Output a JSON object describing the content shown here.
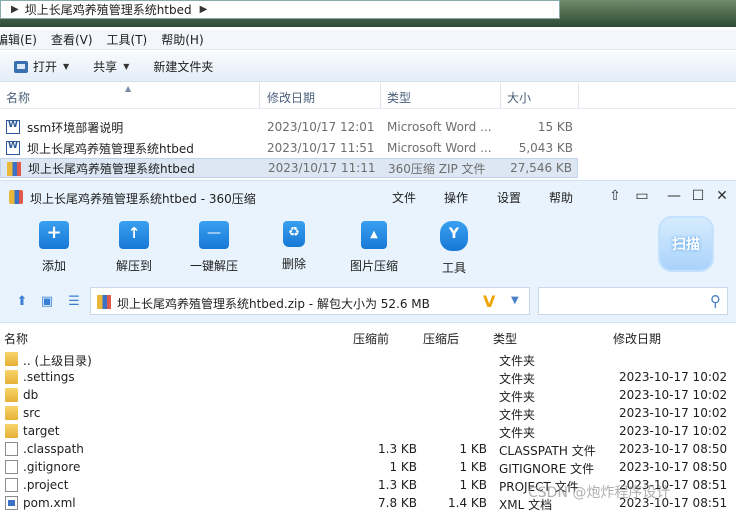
{
  "explorer": {
    "breadcrumb": [
      "坝上长尾鸡养殖管理系统htbed"
    ],
    "menu": [
      "编辑(E)",
      "查看(V)",
      "工具(T)",
      "帮助(H)"
    ],
    "toolbar": {
      "open": "打开",
      "share": "共享",
      "new_folder": "新建文件夹"
    },
    "columns": {
      "name": "名称",
      "date": "修改日期",
      "type": "类型",
      "size": "大小"
    },
    "files": [
      {
        "name": "ssm环境部署说明",
        "date": "2023/10/17 12:01",
        "type": "Microsoft Word ...",
        "size": "15 KB",
        "icon": "word-icon"
      },
      {
        "name": "坝上长尾鸡养殖管理系统htbed",
        "date": "2023/10/17 11:51",
        "type": "Microsoft Word ...",
        "size": "5,043 KB",
        "icon": "word-icon"
      },
      {
        "name": "坝上长尾鸡养殖管理系统htbed",
        "date": "2023/10/17 11:11",
        "type": "360压缩 ZIP 文件",
        "size": "27,546 KB",
        "icon": "zip-icon"
      }
    ]
  },
  "zip": {
    "title": "坝上长尾鸡养殖管理系统htbed - 360压缩",
    "menu": [
      "文件",
      "操作",
      "设置",
      "帮助"
    ],
    "tools": [
      "添加",
      "解压到",
      "一键解压",
      "删除",
      "图片压缩",
      "工具"
    ],
    "scan": "扫描",
    "path": "坝上长尾鸡养殖管理系统htbed.zip - 解包大小为 52.6 MB",
    "columns": {
      "name": "名称",
      "orig": "压缩前",
      "comp": "压缩后",
      "type": "类型",
      "date": "修改日期"
    },
    "rows": [
      {
        "name": ".. (上级目录)",
        "orig": "",
        "comp": "",
        "type": "文件夹",
        "date": "",
        "icon": "folder-icon"
      },
      {
        "name": ".settings",
        "orig": "",
        "comp": "",
        "type": "文件夹",
        "date": "2023-10-17 10:02",
        "icon": "folder-icon"
      },
      {
        "name": "db",
        "orig": "",
        "comp": "",
        "type": "文件夹",
        "date": "2023-10-17 10:02",
        "icon": "folder-icon"
      },
      {
        "name": "src",
        "orig": "",
        "comp": "",
        "type": "文件夹",
        "date": "2023-10-17 10:02",
        "icon": "folder-icon"
      },
      {
        "name": "target",
        "orig": "",
        "comp": "",
        "type": "文件夹",
        "date": "2023-10-17 10:02",
        "icon": "folder-icon"
      },
      {
        "name": ".classpath",
        "orig": "1.3 KB",
        "comp": "1 KB",
        "type": "CLASSPATH 文件",
        "date": "2023-10-17 08:50",
        "icon": "file-icon"
      },
      {
        "name": ".gitignore",
        "orig": "1 KB",
        "comp": "1 KB",
        "type": "GITIGNORE 文件",
        "date": "2023-10-17 08:50",
        "icon": "file-icon"
      },
      {
        "name": ".project",
        "orig": "1.3 KB",
        "comp": "1 KB",
        "type": "PROJECT 文件",
        "date": "2023-10-17 08:51",
        "icon": "file-icon"
      },
      {
        "name": "pom.xml",
        "orig": "7.8 KB",
        "comp": "1.4 KB",
        "type": "XML 文档",
        "date": "2023-10-17 08:51",
        "icon": "xml-icon"
      }
    ]
  },
  "watermark": "CSDN @炮炸程序设计"
}
